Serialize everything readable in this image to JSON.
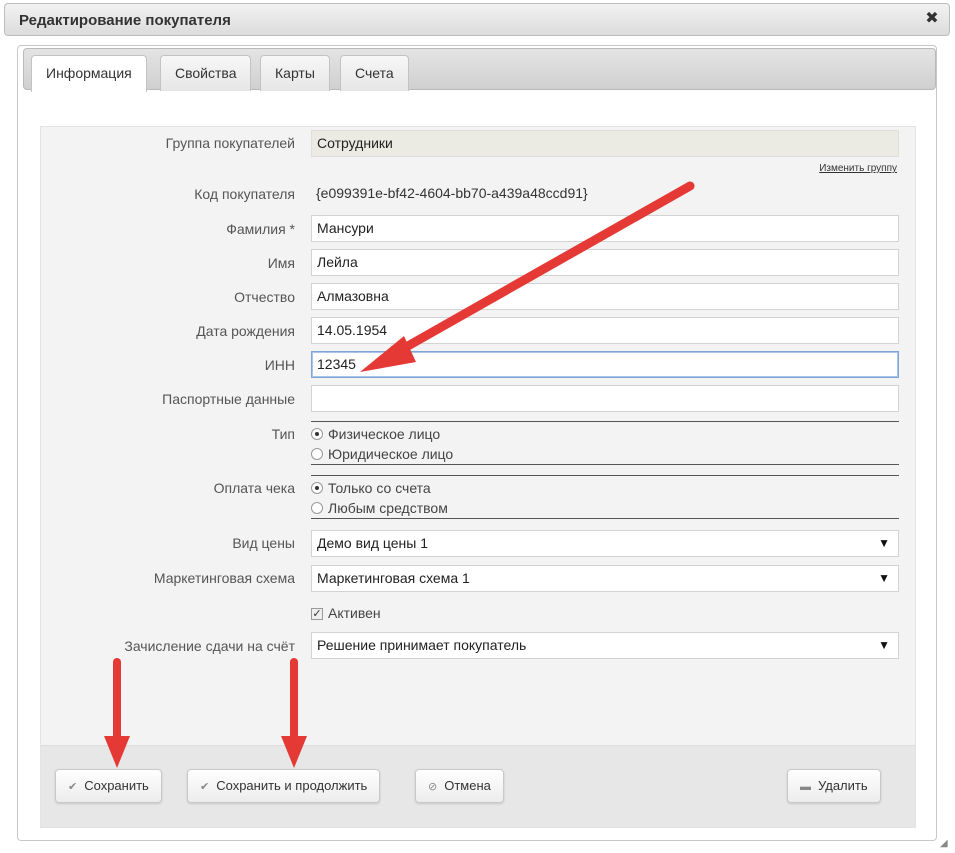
{
  "window": {
    "title": "Редактирование покупателя"
  },
  "tabs": [
    "Информация",
    "Свойства",
    "Карты",
    "Счета"
  ],
  "form": {
    "group": {
      "label": "Группа покупателей",
      "value": "Сотрудники",
      "link": "Изменить группу"
    },
    "code": {
      "label": "Код покупателя",
      "value": "{e099391e-bf42-4604-bb70-a439a48ccd91}"
    },
    "lastname": {
      "label": "Фамилия *",
      "value": "Мансури"
    },
    "firstname": {
      "label": "Имя",
      "value": "Лейла"
    },
    "patronymic": {
      "label": "Отчество",
      "value": "Алмазовна"
    },
    "birthdate": {
      "label": "Дата рождения",
      "value": "14.05.1954"
    },
    "inn": {
      "label": "ИНН",
      "value": "12345"
    },
    "passport": {
      "label": "Паспортные данные",
      "value": ""
    },
    "type": {
      "label": "Тип",
      "options": [
        "Физическое лицо",
        "Юридическое лицо"
      ],
      "selected": "Физическое лицо"
    },
    "payment": {
      "label": "Оплата чека",
      "options": [
        "Только со счета",
        "Любым средством"
      ],
      "selected": "Только со счета"
    },
    "price_type": {
      "label": "Вид цены",
      "value": "Демо вид цены 1"
    },
    "marketing": {
      "label": "Маркетинговая схема",
      "value": "Маркетинговая схема 1"
    },
    "active": {
      "label": "Активен",
      "checked": true
    },
    "change": {
      "label": "Зачисление сдачи на счёт",
      "value": "Решение принимает покупатель"
    }
  },
  "buttons": {
    "save": "Сохранить",
    "save_continue": "Сохранить и продолжить",
    "cancel": "Отмена",
    "delete": "Удалить"
  },
  "colors": {
    "arrow": "#e53935"
  }
}
